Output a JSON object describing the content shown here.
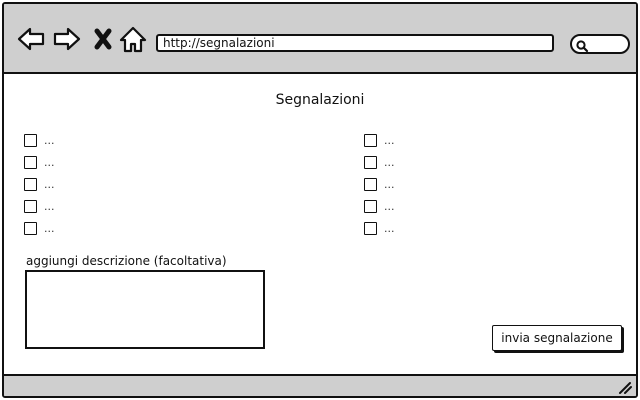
{
  "browser": {
    "url": "http://segnalazioni",
    "icons": {
      "back": "arrow-left-icon",
      "forward": "arrow-right-icon",
      "stop": "close-icon",
      "home": "home-icon",
      "search": "search-icon",
      "resize": "resize-grip-icon"
    }
  },
  "page": {
    "title": "Segnalazioni",
    "checklist_left": [
      {
        "label": "...",
        "checked": false
      },
      {
        "label": "...",
        "checked": false
      },
      {
        "label": "...",
        "checked": false
      },
      {
        "label": "...",
        "checked": false
      },
      {
        "label": "...",
        "checked": false
      }
    ],
    "checklist_right": [
      {
        "label": "...",
        "checked": false
      },
      {
        "label": "...",
        "checked": false
      },
      {
        "label": "...",
        "checked": false
      },
      {
        "label": "...",
        "checked": false
      },
      {
        "label": "...",
        "checked": false
      }
    ],
    "description_label": "aggiungi descrizione (facoltativa)",
    "description_value": "",
    "submit_label": "invia segnalazione"
  },
  "colors": {
    "chrome": "#cfcfcf",
    "stroke": "#111111",
    "background": "#ffffff"
  }
}
